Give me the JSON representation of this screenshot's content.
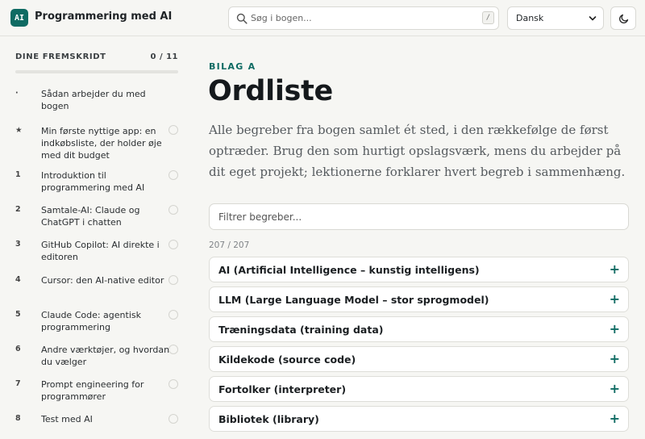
{
  "header": {
    "logo_text": "AI",
    "app_title": "Programmering med AI",
    "search_placeholder": "Søg i bogen...",
    "search_shortcut": "/",
    "language": "Dansk",
    "theme_icon": "moon-icon"
  },
  "sidebar": {
    "progress_title": "DINE FREMSKRIDT",
    "progress_count": "0 / 11",
    "progress_value": 0,
    "items": [
      {
        "num": "·",
        "label": "Sådan arbejder du med bogen",
        "has_circle": false
      },
      {
        "num": "★",
        "label": "Min første nyttige app: en indkøbsliste, der holder øje med dit budget",
        "has_circle": true
      },
      {
        "num": "1",
        "label": "Introduktion til programmering med AI",
        "has_circle": true
      },
      {
        "num": "2",
        "label": "Samtale-AI: Claude og ChatGPT i chatten",
        "has_circle": true
      },
      {
        "num": "3",
        "label": "GitHub Copilot: AI direkte i editoren",
        "has_circle": true
      },
      {
        "num": "4",
        "label": "Cursor: den AI-native editor",
        "has_circle": true
      },
      {
        "num": "5",
        "label": "Claude Code: agentisk programmering",
        "has_circle": true
      },
      {
        "num": "6",
        "label": "Andre værktøjer, og hvordan du vælger",
        "has_circle": true
      },
      {
        "num": "7",
        "label": "Prompt engineering for programmører",
        "has_circle": true
      },
      {
        "num": "8",
        "label": "Test med AI",
        "has_circle": true
      }
    ]
  },
  "main": {
    "eyebrow": "BILAG A",
    "title": "Ordliste",
    "intro": "Alle begreber fra bogen samlet ét sted, i den rækkefølge de først optræder. Brug den som hurtigt opslagsværk, mens du arbejder på dit eget projekt; lektionerne forklarer hvert begreb i sammenhæng.",
    "filter_placeholder": "Filtrer begreber...",
    "count": "207 / 207",
    "terms": [
      "AI (Artificial Intelligence – kunstig intelligens)",
      "LLM (Large Language Model – stor sprogmodel)",
      "Træningsdata (training data)",
      "Kildekode (source code)",
      "Fortolker (interpreter)",
      "Bibliotek (library)"
    ],
    "expand_symbol": "+"
  },
  "colors": {
    "accent": "#0f6b63",
    "background": "#f6f6f3"
  }
}
